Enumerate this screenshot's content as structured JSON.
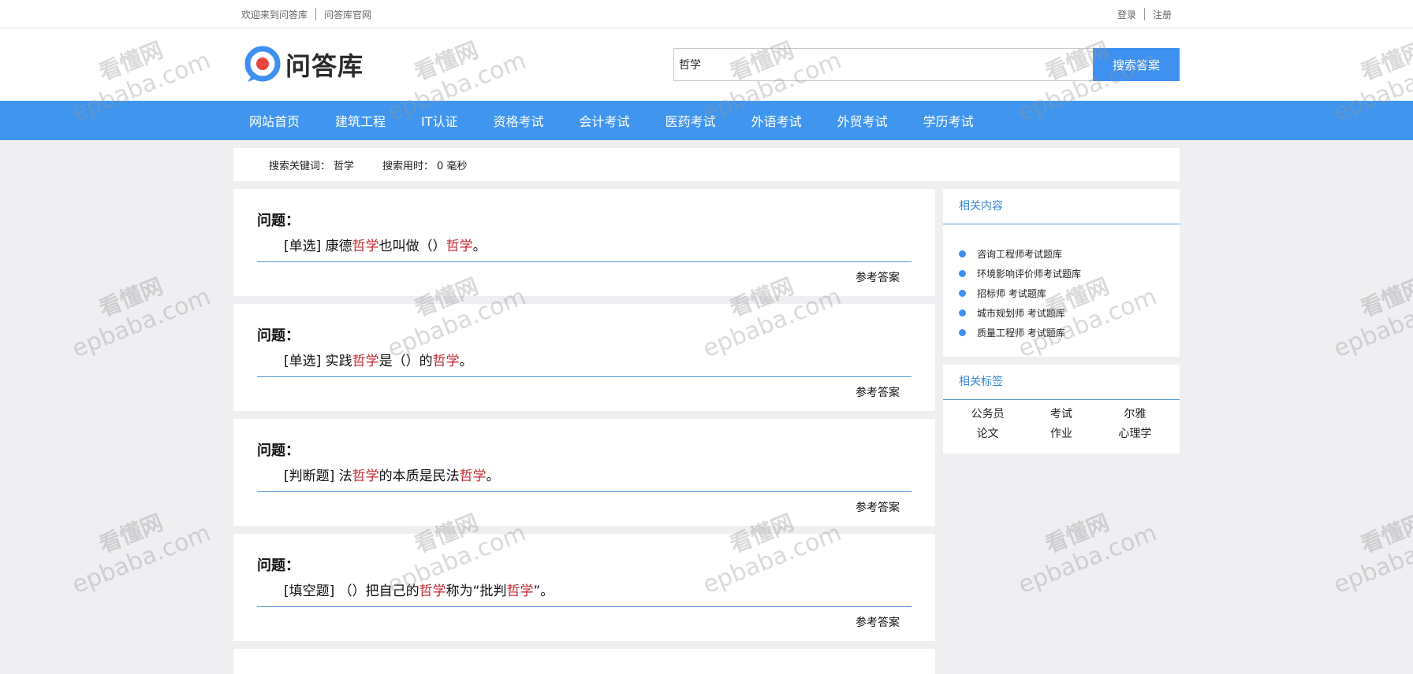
{
  "topbar": {
    "welcome": "欢迎来到问答库",
    "official": "问答库官网",
    "login": "登录",
    "register": "注册"
  },
  "logo": {
    "text": "问答库"
  },
  "search": {
    "value": "哲学",
    "button": "搜索答案"
  },
  "nav": {
    "items": [
      "网站首页",
      "建筑工程",
      "IT认证",
      "资格考试",
      "会计考试",
      "医药考试",
      "外语考试",
      "外贸考试",
      "学历考试"
    ]
  },
  "info": {
    "keyword_label": "搜索关键词：",
    "keyword": "哲学",
    "time_label": "搜索用时：",
    "time": "0 毫秒"
  },
  "questions": [
    {
      "title": "问题：",
      "parts": [
        "[单选] 康德",
        "哲学",
        "也叫做（）",
        "哲学",
        "。"
      ],
      "answer": "参考答案"
    },
    {
      "title": "问题：",
      "parts": [
        "[单选] 实践",
        "哲学",
        "是（）的",
        "哲学",
        "。"
      ],
      "answer": "参考答案"
    },
    {
      "title": "问题：",
      "parts": [
        "[判断题] 法",
        "哲学",
        "的本质是民法",
        "哲学",
        "。"
      ],
      "answer": "参考答案"
    },
    {
      "title": "问题：",
      "parts": [
        "[填空题] （）把自己的",
        "哲学",
        "称为“批判",
        "哲学",
        "”。"
      ],
      "answer": "参考答案"
    }
  ],
  "related": {
    "title": "相关内容",
    "items": [
      "咨询工程师考试题库",
      "环境影响评价师考试题库",
      "招标师 考试题库",
      "城市规划师 考试题库",
      "质量工程师 考试题库"
    ]
  },
  "tags": {
    "title": "相关标签",
    "items": [
      "公务员",
      "考试",
      "尔雅",
      "论文",
      "作业",
      "心理学"
    ]
  },
  "watermark": {
    "line1": "看懂网",
    "line2": "epbaba.com"
  },
  "colors": {
    "nav": "#4096ee",
    "accent": "#3e91f1",
    "highlight": "#c0272d"
  }
}
